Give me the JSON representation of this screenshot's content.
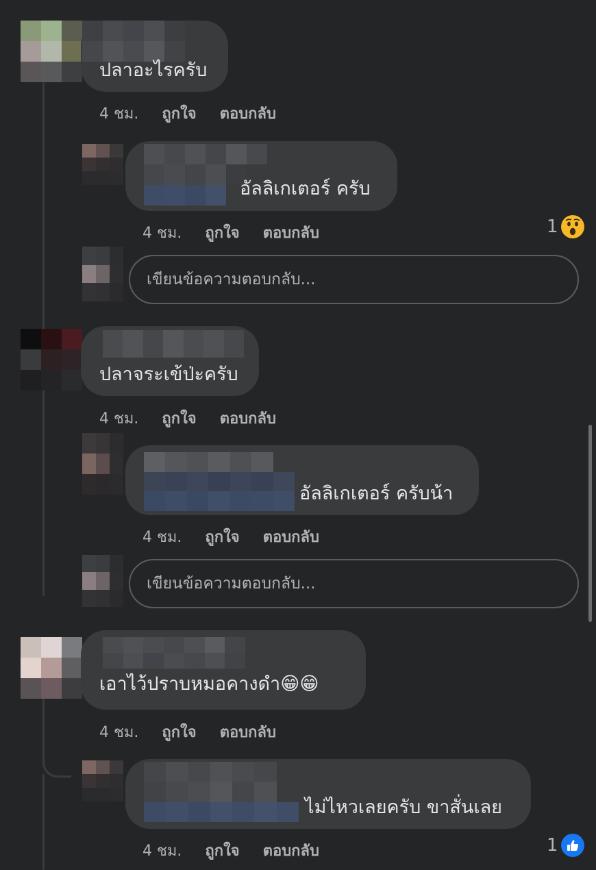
{
  "comments": [
    {
      "text": "ปลาอะไรครับ",
      "time": "4 ชม.",
      "like": "ถูกใจ",
      "reply": "ตอบกลับ",
      "reply_item": {
        "text": "อัลลิเกเตอร์ ครับ",
        "time": "4 ชม.",
        "like": "ถูกใจ",
        "reply": "ตอบกลับ",
        "reaction_count": "1",
        "reaction_icon": "wow-icon"
      },
      "reply_input_placeholder": "เขียนข้อความตอบกลับ..."
    },
    {
      "text": "ปลาจระเข้ป่ะครับ",
      "time": "4 ชม.",
      "like": "ถูกใจ",
      "reply": "ตอบกลับ",
      "reply_item": {
        "text": "อัลลิเกเตอร์ ครับน้า",
        "time": "4 ชม.",
        "like": "ถูกใจ",
        "reply": "ตอบกลับ"
      },
      "reply_input_placeholder": "เขียนข้อความตอบกลับ..."
    },
    {
      "text": "เอาไว้ปราบหมอคางดำ",
      "emoji": "😁😁",
      "time": "4 ชม.",
      "like": "ถูกใจ",
      "reply": "ตอบกลับ",
      "reply_item": {
        "text": "ไม่ไหวเลยครับ ขาสั่นเลย",
        "time": "4 ชม.",
        "like": "ถูกใจ",
        "reply": "ตอบกลับ",
        "reaction_count": "1",
        "reaction_icon": "like-icon"
      }
    }
  ],
  "colors": {
    "background": "#242526",
    "bubble": "#3a3b3c",
    "meta": "#b0b3b8",
    "like_blue": "#1877f2",
    "wow_yellow": "#f7b928"
  }
}
